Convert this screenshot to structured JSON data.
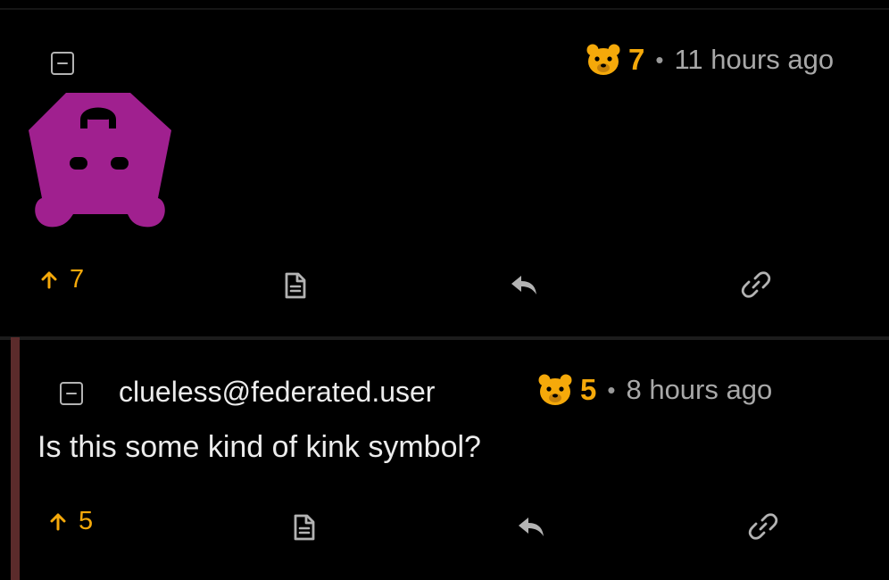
{
  "theme": {
    "background": "#000000",
    "accent": "#f5a90a",
    "thread_bar": "#5b2b2b",
    "emoji_color": "#a0208f"
  },
  "comment1": {
    "score": "7",
    "separator": "•",
    "timestamp": "11 hours ago",
    "image_icon": "purple-mask-emoji-icon",
    "upvotes": "7",
    "actions": [
      "upvote-icon",
      "document-icon",
      "reply-icon",
      "link-icon"
    ]
  },
  "comment2": {
    "username": "clueless@federated.user",
    "score": "5",
    "separator": "•",
    "timestamp": "8 hours ago",
    "text": "Is this some kind of kink symbol?",
    "upvotes": "5",
    "actions": [
      "upvote-icon",
      "document-icon",
      "reply-icon",
      "link-icon"
    ]
  }
}
